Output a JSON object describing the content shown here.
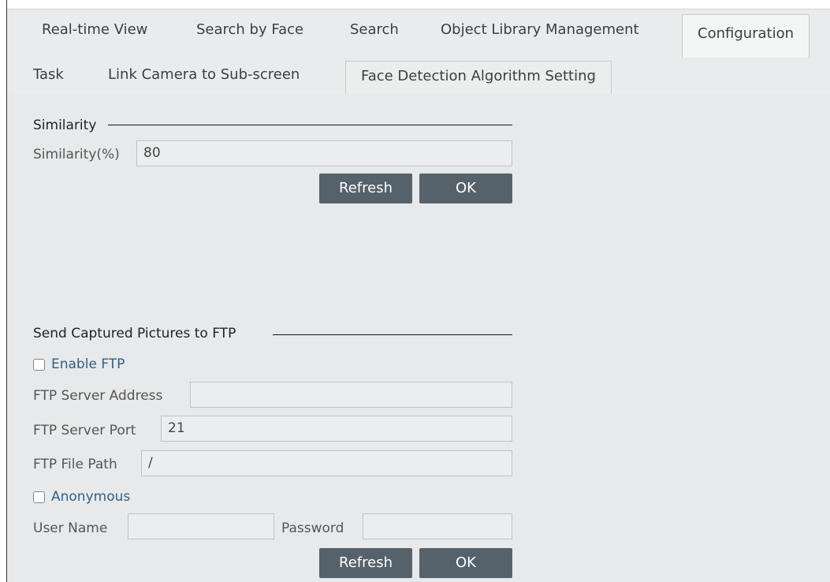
{
  "main_tabs": [
    {
      "label": "Real-time View"
    },
    {
      "label": "Search by Face"
    },
    {
      "label": "Search"
    },
    {
      "label": "Object Library Management"
    },
    {
      "label": "Configuration"
    }
  ],
  "sub_tabs": [
    {
      "label": "Task"
    },
    {
      "label": "Link Camera to Sub-screen"
    },
    {
      "label": "Face Detection Algorithm Setting"
    }
  ],
  "similarity": {
    "section_title": "Similarity",
    "label": "Similarity(%)",
    "value": "80",
    "refresh_label": "Refresh",
    "ok_label": "OK"
  },
  "ftp": {
    "section_title": "Send Captured Pictures to FTP",
    "enable_label": "Enable FTP",
    "enable_checked": false,
    "server_address_label": "FTP Server Address",
    "server_address_value": "",
    "server_port_label": "FTP Server Port",
    "server_port_value": "21",
    "file_path_label": "FTP File Path",
    "file_path_value": "/",
    "anonymous_label": "Anonymous",
    "anonymous_checked": false,
    "user_name_label": "User Name",
    "user_name_value": "",
    "password_label": "Password",
    "password_value": "",
    "refresh_label": "Refresh",
    "ok_label": "OK"
  },
  "colors": {
    "button_bg": "#56626b",
    "panel_bg": "#e8e9ea",
    "checkbox_label": "#2f5f8c"
  }
}
